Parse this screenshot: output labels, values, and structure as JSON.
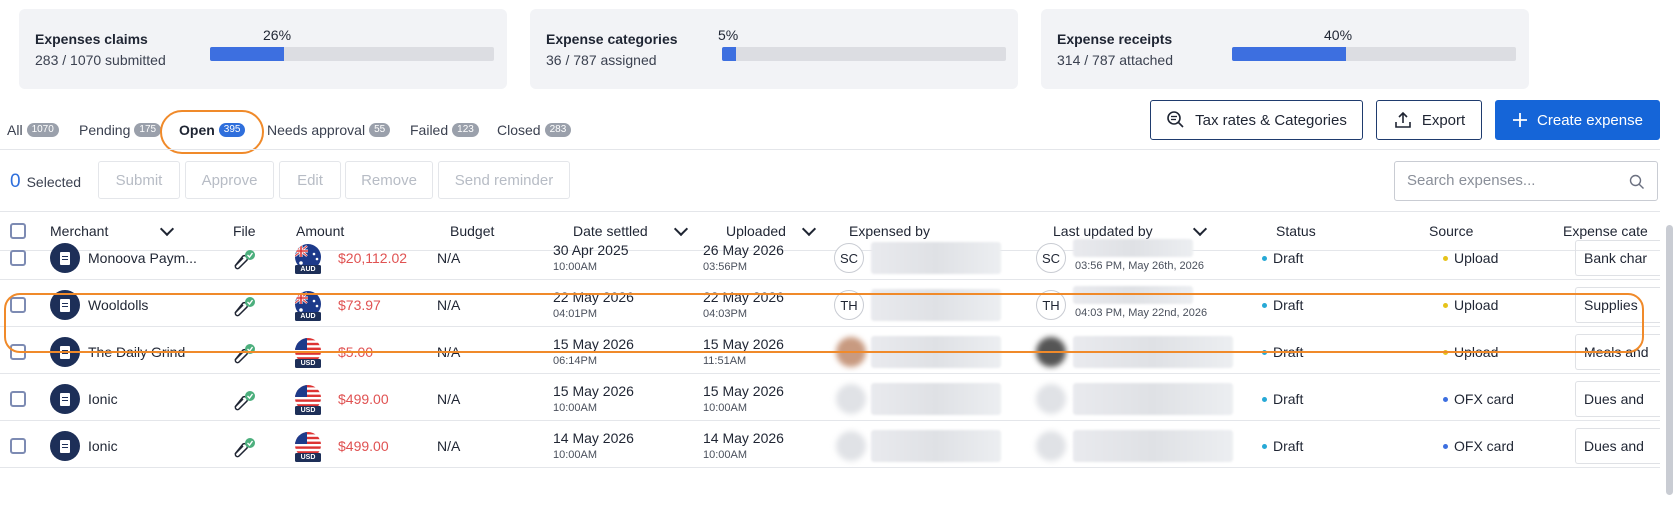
{
  "stats": [
    {
      "label": "Expenses claims",
      "sub": "283 / 1070 submitted",
      "pct_text": "26%",
      "pct": 26
    },
    {
      "label": "Expense categories",
      "sub": "36 / 787 assigned",
      "pct_text": "5%",
      "pct": 5
    },
    {
      "label": "Expense receipts",
      "sub": "314 / 787 attached",
      "pct_text": "40%",
      "pct": 40
    }
  ],
  "tabs": [
    {
      "label": "All",
      "count": "1070"
    },
    {
      "label": "Pending",
      "count": "175"
    },
    {
      "label": "Open",
      "count": "395",
      "active": true
    },
    {
      "label": "Needs approval",
      "count": "55"
    },
    {
      "label": "Failed",
      "count": "123"
    },
    {
      "label": "Closed",
      "count": "283"
    }
  ],
  "toolbar": {
    "tax_label": "Tax rates & Categories",
    "export_label": "Export",
    "create_label": "Create expense"
  },
  "selection": {
    "count": "0",
    "label": "Selected"
  },
  "actions": [
    "Submit",
    "Approve",
    "Edit",
    "Remove",
    "Send reminder"
  ],
  "search": {
    "placeholder": "Search expenses..."
  },
  "columns": {
    "merchant": "Merchant",
    "file": "File",
    "amount": "Amount",
    "budget": "Budget",
    "date_settled": "Date settled",
    "uploaded": "Uploaded",
    "expensed_by": "Expensed by",
    "last_updated_by": "Last updated by",
    "status": "Status",
    "source": "Source",
    "category": "Expense cate"
  },
  "colors": {
    "accent": "#1565d8",
    "draft_dot": "#27a9d6",
    "upload_dot": "#e6c31a",
    "ofx_dot": "#3d6fe0",
    "highlight": "#f08a2a"
  },
  "rows": [
    {
      "merchant": "Monoova Paym...",
      "currency": "AUD",
      "amount": "$20,112.02",
      "budget": "N/A",
      "settled_date": "30 Apr 2025",
      "settled_time": "10:00AM",
      "uploaded_date": "26 May 2026",
      "uploaded_time": "03:56PM",
      "expensed_initials": "SC",
      "updated_initials": "SC",
      "updated_at": "03:56 PM, May 26th, 2026",
      "status": "Draft",
      "source": "Upload",
      "source_dot": "upload",
      "category": "Bank char"
    },
    {
      "merchant": "Wooldolls",
      "currency": "AUD",
      "amount": "$73.97",
      "budget": "N/A",
      "settled_date": "22 May 2026",
      "settled_time": "04:01PM",
      "uploaded_date": "22 May 2026",
      "uploaded_time": "04:03PM",
      "expensed_initials": "TH",
      "updated_initials": "TH",
      "updated_at": "04:03 PM, May 22nd, 2026",
      "status": "Draft",
      "source": "Upload",
      "source_dot": "upload",
      "category": "Supplies"
    },
    {
      "merchant": "The Daily Grind",
      "currency": "USD",
      "amount": "$5.00",
      "budget": "N/A",
      "settled_date": "15 May 2026",
      "settled_time": "06:14PM",
      "uploaded_date": "15 May 2026",
      "uploaded_time": "11:51AM",
      "expensed_initials": "",
      "updated_initials": "",
      "updated_at": "",
      "status": "Draft",
      "source": "Upload",
      "source_dot": "upload",
      "category": "Meals and"
    },
    {
      "merchant": "Ionic",
      "currency": "USD",
      "amount": "$499.00",
      "budget": "N/A",
      "settled_date": "15 May 2026",
      "settled_time": "10:00AM",
      "uploaded_date": "15 May 2026",
      "uploaded_time": "10:00AM",
      "expensed_initials": "",
      "updated_initials": "",
      "updated_at": "",
      "status": "Draft",
      "source": "OFX card",
      "source_dot": "ofx",
      "category": "Dues and"
    },
    {
      "merchant": "Ionic",
      "currency": "USD",
      "amount": "$499.00",
      "budget": "N/A",
      "settled_date": "14 May 2026",
      "settled_time": "10:00AM",
      "uploaded_date": "14 May 2026",
      "uploaded_time": "10:00AM",
      "expensed_initials": "",
      "updated_initials": "",
      "updated_at": "",
      "status": "Draft",
      "source": "OFX card",
      "source_dot": "ofx",
      "category": "Dues and"
    }
  ]
}
